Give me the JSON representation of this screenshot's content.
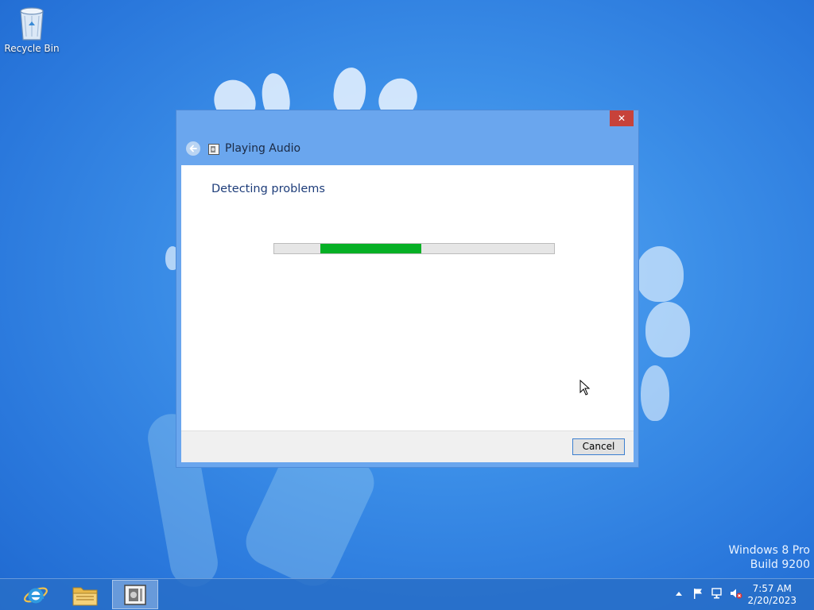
{
  "desktop": {
    "icons": [
      {
        "label": "Recycle Bin",
        "icon": "recycle-bin-icon"
      }
    ],
    "watermark": {
      "line1": "Windows 8 Pro",
      "line2": "Build 9200"
    }
  },
  "dialog": {
    "title": "Playing Audio",
    "close_label": "✕",
    "heading": "Detecting problems",
    "progress": {
      "state": "indeterminate",
      "color": "#06b025"
    },
    "cancel_label": "Cancel"
  },
  "taskbar": {
    "pinned": [
      {
        "name": "internet-explorer",
        "icon": "internet-explorer-icon"
      },
      {
        "name": "file-explorer",
        "icon": "folder-icon"
      },
      {
        "name": "troubleshooter",
        "icon": "troubleshooter-icon",
        "active": true
      }
    ],
    "tray": {
      "icons": [
        "show-hidden-icons-arrow",
        "action-center-flag-icon",
        "network-icon",
        "volume-muted-icon"
      ]
    },
    "clock": {
      "time": "7:57 AM",
      "date": "2/20/2023"
    }
  },
  "colors": {
    "desktop_background": "#2a78dc",
    "window_frame": "#6aa6ee",
    "close_button": "#c7423a",
    "heading_text": "#1e3d7a"
  }
}
